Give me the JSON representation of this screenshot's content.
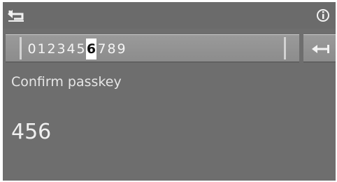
{
  "header": {
    "back_icon": "back-return-icon",
    "info_icon": "info-icon"
  },
  "keypad": {
    "digits": [
      "0",
      "1",
      "2",
      "3",
      "4",
      "5",
      "6",
      "7",
      "8",
      "9"
    ],
    "selected_digit": "6",
    "enter_icon": "backspace-arrow-icon"
  },
  "prompt": {
    "label": "Confirm passkey",
    "value": "456"
  }
}
